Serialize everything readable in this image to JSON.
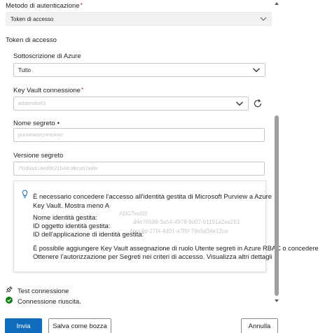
{
  "auth": {
    "label": "Metodo di autenticazione",
    "value": "Token di accesso"
  },
  "section_title": "Token di accesso",
  "subscription": {
    "label": "Sottoscrizione di Azure",
    "value": "Tutto"
  },
  "keyvault": {
    "label": "Key Vault connessione",
    "value": "adatestkv01"
  },
  "secret_name": {
    "label": "Nome segreto",
    "placeholder": "purviewsecrettoken"
  },
  "secret_version": {
    "label": "Versione segreto",
    "placeholder": "7f0d9a314ed0b21b48c9bca52a8fe"
  },
  "info": {
    "line1": "È necessario concedere l'accesso all'identità gestita di Microsoft Purview a Azure",
    "line2": "Key Vault. Mostra meno A",
    "name_label": "Nome identità gestita:",
    "name_value": "ADGTest02",
    "object_label": "ID oggetto identità gestita:",
    "object_value": "d4e76599-3a54-4978-9d07-91191a2ea251",
    "app_label": "ID dell'applicazione di identità gestita:",
    "app_value": "4ecc4d-27f4-4d01-a7f6f-79e5d34e12ce",
    "line6": "È possibile aggiungere Key Vault assegnazione di ruolo Utente segreti in Azure RBAC o concedere",
    "line7": "Ottenere l'autorizzazione per Segreti nei criteri di accesso. Visualizza altri dettagli"
  },
  "test": {
    "label": "Test connessione",
    "status": "Connessione riuscita."
  },
  "footer": {
    "primary": "Invia",
    "draft": "Salva come bozza",
    "cancel": "Annulla"
  },
  "colors": {
    "primary": "#0f6cbd",
    "success": "#107c10",
    "info": "#0f6cbd"
  }
}
